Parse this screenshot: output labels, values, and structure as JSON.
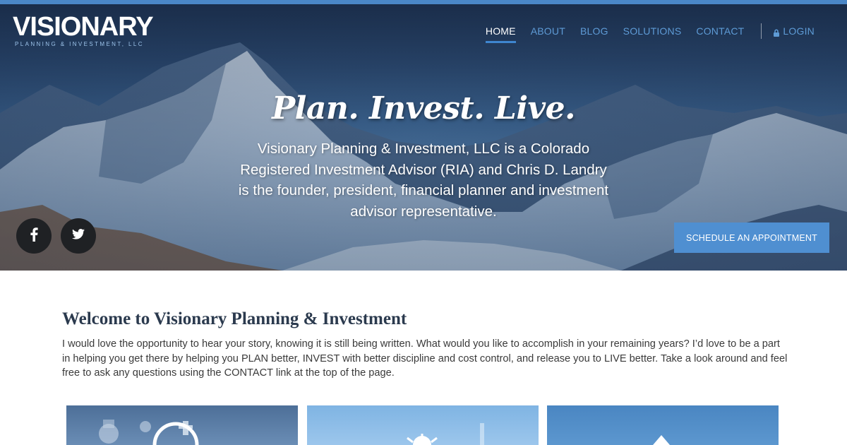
{
  "brand": {
    "name": "VISIONARY",
    "subtitle": "PLANNING & INVESTMENT, LLC"
  },
  "nav": {
    "items": [
      {
        "label": "HOME",
        "active": true
      },
      {
        "label": "ABOUT",
        "active": false
      },
      {
        "label": "BLOG",
        "active": false
      },
      {
        "label": "SOLUTIONS",
        "active": false
      },
      {
        "label": "CONTACT",
        "active": false
      }
    ],
    "login_label": "LOGIN",
    "login_icon": "lock-icon"
  },
  "hero": {
    "tagline": "Plan. Invest. Live.",
    "description": "Visionary Planning & Investment, LLC is a Colorado Registered Investment Advisor (RIA) and Chris D. Landry is the founder, president, financial planner and investment advisor representative.",
    "cta_label": "SCHEDULE AN APPOINTMENT",
    "social": [
      {
        "name": "facebook",
        "icon": "facebook-icon"
      },
      {
        "name": "twitter",
        "icon": "twitter-icon"
      }
    ]
  },
  "welcome": {
    "title": "Welcome to Visionary Planning & Investment",
    "body": "I would love the opportunity to hear your story, knowing it is still being written. What would you like to accomplish in your remaining years? I’d love to be a part in helping you get there by helping you PLAN better, INVEST with better discipline and cost control, and release you to LIVE better. Take a look around and feel free to ask any questions using the CONTACT link at the top of the page."
  },
  "colors": {
    "accent": "#4f8fd1",
    "nav_link": "#5e9bd6",
    "social_bg": "#1f2124",
    "heading": "#2b3a4e"
  }
}
